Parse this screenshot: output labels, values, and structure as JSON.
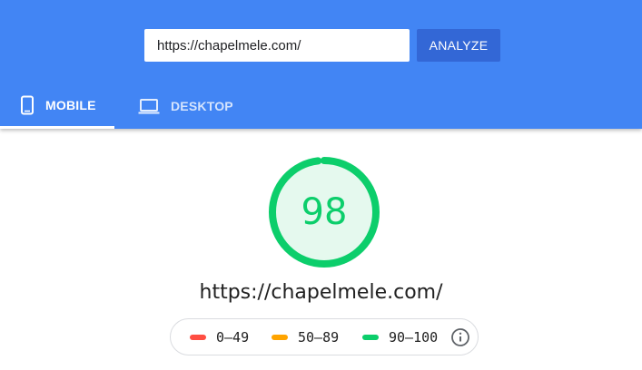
{
  "search": {
    "url_value": "https://chapelmele.com/",
    "analyze_label": "ANALYZE"
  },
  "tabs": [
    {
      "label": "MOBILE",
      "icon": "phone-icon",
      "selected": true
    },
    {
      "label": "DESKTOP",
      "icon": "laptop-icon",
      "selected": false
    }
  ],
  "report": {
    "score": "98",
    "score_fraction": 0.98,
    "url": "https://chapelmele.com/"
  },
  "legend": {
    "items": [
      {
        "range": "0–49",
        "color": "#ff4e42"
      },
      {
        "range": "50–89",
        "color": "#ffa400"
      },
      {
        "range": "90–100",
        "color": "#0cce6b"
      }
    ],
    "info_icon": "info-icon"
  },
  "colors": {
    "header_bg": "#4285f4",
    "button_bg": "#3367d6",
    "pass_green": "#0cce6b",
    "gauge_fill": "#e5f9ee"
  }
}
